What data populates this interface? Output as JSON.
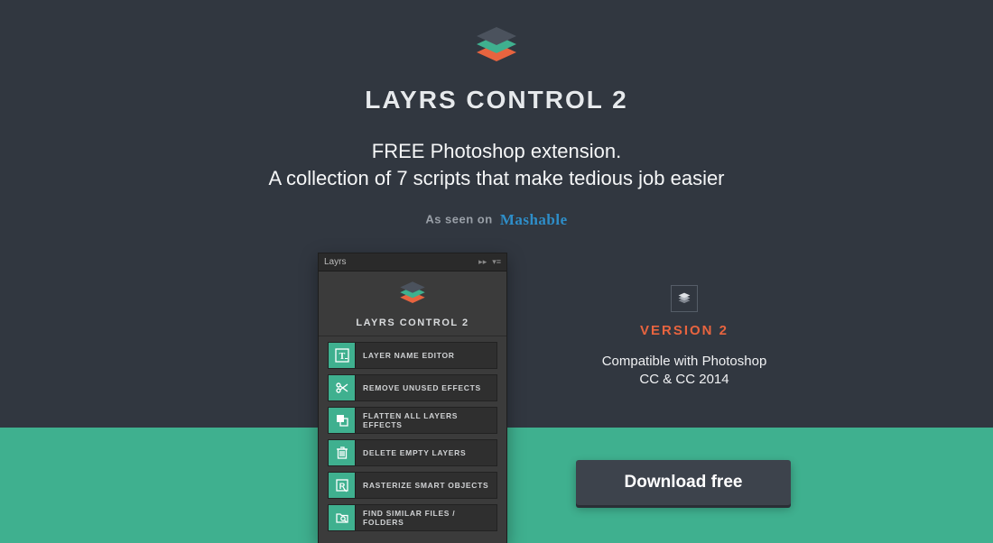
{
  "hero": {
    "title": "LAYRS CONTROL 2",
    "subtitle_line1": "FREE Photoshop extension.",
    "subtitle_line2": "A collection of 7 scripts that make tedious job easier",
    "asseen_prefix": "As seen on",
    "asseen_brand": "Mashable"
  },
  "panel": {
    "tab_label": "Layrs",
    "title": "LAYRS CONTROL 2",
    "scripts": [
      {
        "icon": "text-icon",
        "label": "LAYER NAME EDITOR"
      },
      {
        "icon": "scissors-icon",
        "label": "REMOVE UNUSED EFFECTS"
      },
      {
        "icon": "flatten-icon",
        "label": "FLATTEN ALL LAYERS EFFECTS"
      },
      {
        "icon": "trash-icon",
        "label": "DELETE EMPTY LAYERS"
      },
      {
        "icon": "rasterize-icon",
        "label": "RASTERIZE SMART OBJECTS"
      },
      {
        "icon": "search-folder-icon",
        "label": "FIND SIMILAR FILES / FOLDERS"
      }
    ]
  },
  "right": {
    "version_label": "VERSION 2",
    "compat_line1": "Compatible with Photoshop",
    "compat_line2": "CC & CC 2014"
  },
  "cta": {
    "download_label": "Download free"
  },
  "colors": {
    "accent_green": "#3fb08f",
    "accent_orange": "#e8643f",
    "bg_dark": "#313740"
  }
}
